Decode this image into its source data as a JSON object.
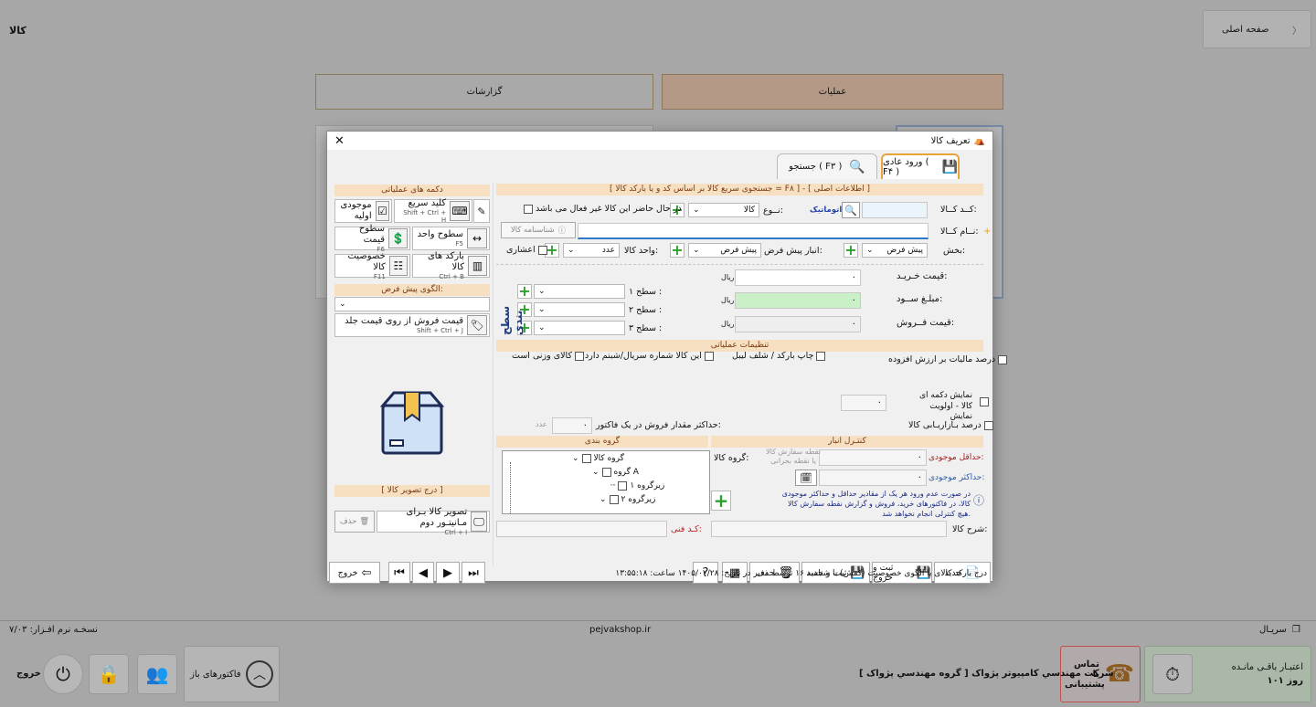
{
  "app": {
    "page_title": "کالا",
    "home_label": "صفحه اصلی",
    "tabs": {
      "operations": "عملیات",
      "reports": "گزارشات"
    }
  },
  "footer": {
    "serial": "سریـال",
    "website": "pejvakshop.ir",
    "version": "نسخـه نرم افـزار: ۷/۰۳",
    "company": "شرکت مهندسي کامپيوتر پژواک [ گروه مهندسي پژواک ]",
    "credit_title": "اعتبـار باقـی مانـده",
    "credit_value": "۱۰۱ روز",
    "support": "تماس با پشتیبانی",
    "open_invoices": "فاکتورهای باز",
    "exit": "خروج"
  },
  "dialog": {
    "title": "تعریف کالا",
    "tabs": {
      "normal": "ورود عادی ( F۴ )",
      "search": "جستجو ( F۳ )"
    },
    "quick_search": "[ جستجوی سریع کالا بر اساس کد و یا بارکد کالا = F۸ ] - [ اطلاعات اصلی ]",
    "fields": {
      "code": "کــد کــالا:",
      "auto": "اتوماتیک",
      "type_label": "نــوع:",
      "type_value": "کالا",
      "inactive": "در حال حاضر این کالا غیر فعال می باشد",
      "name": "نــام کــالا:",
      "card": "شناسنامه کالا",
      "section": "بخش:",
      "section_value": "پیش فرض",
      "warehouse": "انبار پیش فرض:",
      "warehouse_value": "پیش فرض",
      "unit": "واحد کالا:",
      "unit_value": "عدد",
      "decimal": "اعشاری",
      "buy": "قیمت خـریـد:",
      "profit": "مبلـغ ســود:",
      "sell": "قیمت فــروش:",
      "rial": "ریال",
      "zero": "۰",
      "level1": "سطح ۱ :",
      "level2": "سطح ۲ :",
      "level3": "سطح ۳ :",
      "leveling": "سطح بندی"
    },
    "ops": {
      "title": "تنظیمات عملیاتی",
      "vat": "درصد مالیات بر ارزش افزوده",
      "barcode_print": "چاپ بارکد / شلف لیبل",
      "serial": "این کالا شماره سریال/شبنم دارد",
      "weight": "کالای وزنی است",
      "show_button": "نمایش دکمه ای کالا - اولویت نمایش",
      "market": "درصد بـازاریـابی کالا",
      "max_sale": "حداکثر مقدار فروش در یک فاکتور:",
      "each": "عدد",
      "zero": "۰"
    },
    "inventory": {
      "title": "کنتـرل انبار",
      "min": "حداقل موجودی:",
      "max": "حداکثر موجودی:",
      "reorder": "نقطه سفارش کالا یا نقطه بحرانی",
      "note": "در صورت عدم ورود هر یک از مقادیر حداقل و حداکثر موجودی کالا، در فاکتورهای خرید، فروش و گزارش نقطه سفارش کالا هیچ کنترلی انجام نخواهد شد.",
      "zero": "۰"
    },
    "grouping": {
      "title": "گروه بندی",
      "label": "گروه کالا:",
      "root": "گروه کالا",
      "groupA": "گروه A",
      "sub1": "زیرگروه ۱",
      "sub2": "زیرگروه ۲"
    },
    "desc": "شرح کالا:",
    "tech_code": "کـد فنی:",
    "left": {
      "ops_title": "دکمه های عملیاتی",
      "quick_key": "کلید سریع",
      "quick_key_sc": "Shift + Ctrl + H",
      "stock": "موجودی اولیه",
      "unit_levels": "سطوح واحد",
      "unit_levels_sc": "F5",
      "price_levels": "سطوح قیمت",
      "price_levels_sc": "F6",
      "barcodes": "بارکد های کالا",
      "barcodes_sc": "Ctrl + B",
      "props": "خصوصیت کالا",
      "props_sc": "F11",
      "pattern_title": "الگوی پیش فرض:",
      "price_from_cover": "قیمت فروش از روی قیمت جلد",
      "price_from_cover_sc": "Shift + Ctrl + J",
      "image_title": "[ درج تصویر کالا ]",
      "monitor": "تصویر کالا بـرای مـانیتـور دوم",
      "monitor_sc": "Ctrl + I",
      "delete": "حذف"
    },
    "toolbar": {
      "new": "جدید",
      "save_exit": "ثبت و خروج",
      "save_new": "ثبت و جدید",
      "delete": "حذف",
      "exit": "خروج"
    },
    "status": "درج  بارکد کالای با الگوی خصوصیت (کفش) با شناسه ۱۶ توسط مدیر در تاریخ: ۱۴۰۵/۰۲/۲۸ ساعت: ۱۳:۵۵:۱۸"
  }
}
